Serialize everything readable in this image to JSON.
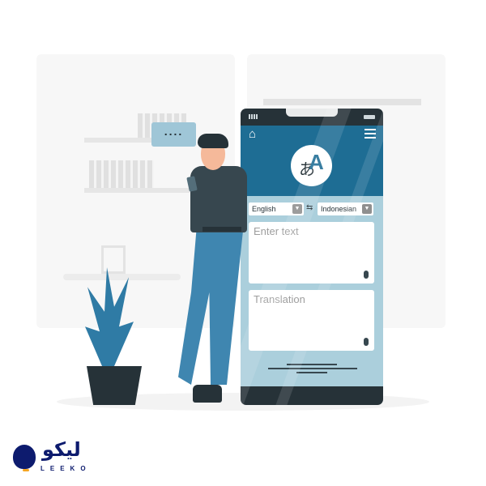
{
  "phone": {
    "home_icon": "home-icon",
    "menu_icon": "hamburger-menu-icon",
    "logo_icon": "translate-icon",
    "logo_glyphs": {
      "kana": "あ",
      "latin": "A"
    },
    "source_language": "English",
    "target_language": "Indonesian",
    "swap_icon": "swap-arrows-icon",
    "input_placeholder": "Enter text",
    "output_placeholder": "Translation",
    "mic_icon": "microphone-icon"
  },
  "speech_bubble": "....",
  "brand": {
    "arabic": "لیکو",
    "latin": "LEEKO",
    "color": "#0d1b6e",
    "accent": "#f5a623"
  },
  "colors": {
    "header": "#1e6d94",
    "body": "#abcfdc",
    "frame": "#263238"
  }
}
